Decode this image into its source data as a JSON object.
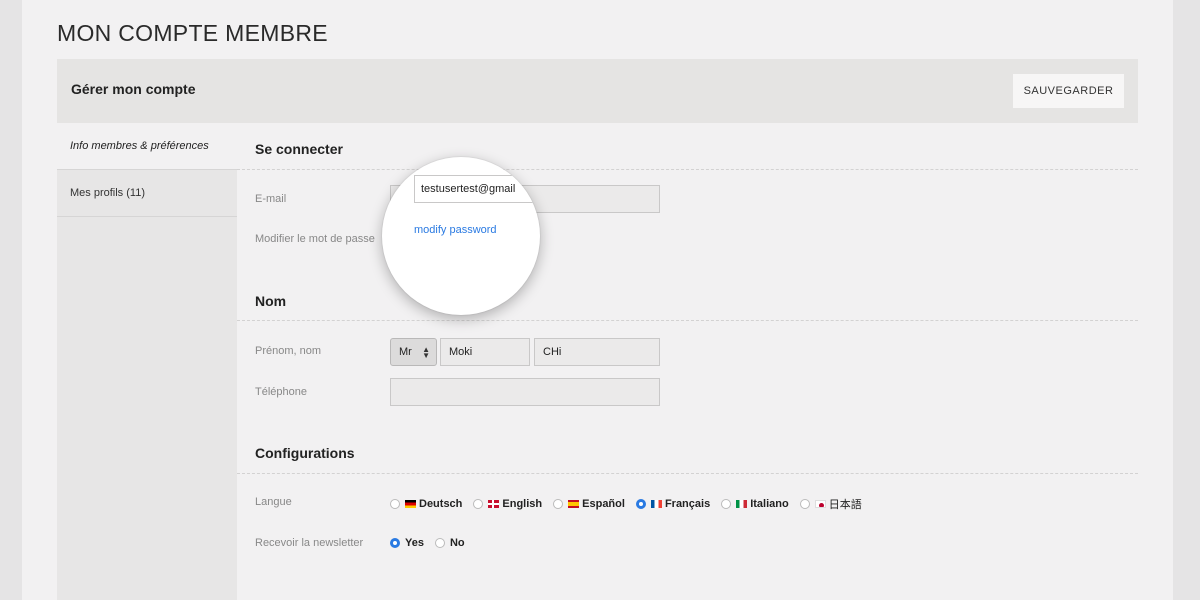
{
  "page": {
    "title": "MON COMPTE MEMBRE"
  },
  "header": {
    "title": "Gérer mon compte",
    "save_label": "SAUVEGARDER"
  },
  "sidebar": {
    "items": [
      {
        "label": "Info membres & préférences",
        "active": true
      },
      {
        "label": "Mes profils (11)",
        "active": false
      }
    ]
  },
  "connect": {
    "title": "Se connecter",
    "email_label": "E-mail",
    "email_value": "testusertest@gmail",
    "password_label": "Modifier le mot de passe",
    "password_link": "modify password"
  },
  "name": {
    "title": "Nom",
    "fullname_label": "Prénom, nom",
    "civility": "Mr",
    "first_name": "Moki",
    "last_name": "CHi",
    "phone_label": "Téléphone",
    "phone_value": ""
  },
  "config": {
    "title": "Configurations",
    "language_label": "Langue",
    "languages": [
      {
        "label": "Deutsch",
        "flag": "flag-de",
        "selected": false
      },
      {
        "label": "English",
        "flag": "flag-en",
        "selected": false
      },
      {
        "label": "Español",
        "flag": "flag-es",
        "selected": false
      },
      {
        "label": "Français",
        "flag": "flag-fr",
        "selected": true
      },
      {
        "label": "Italiano",
        "flag": "flag-it",
        "selected": false
      },
      {
        "label": "日本語",
        "flag": "flag-jp",
        "selected": false
      }
    ],
    "newsletter_label": "Recevoir la newsletter",
    "newsletter_options": [
      {
        "label": "Yes",
        "selected": true
      },
      {
        "label": "No",
        "selected": false
      }
    ]
  },
  "colors": {
    "accent": "#2a7ae2",
    "background": "#f2f1f2",
    "header_bar": "#e5e4e3"
  }
}
